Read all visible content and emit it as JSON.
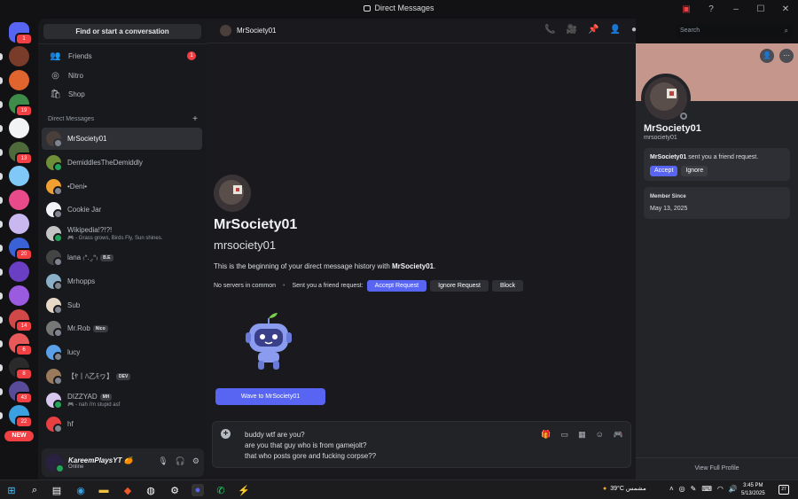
{
  "window": {
    "title": "Direct Messages"
  },
  "servers": [
    {
      "color": "#5865f2",
      "badge": "1"
    },
    {
      "color": "#7a3c2a",
      "badge": ""
    },
    {
      "color": "#e0642e",
      "badge": ""
    },
    {
      "color": "#3e8c4a",
      "badge": "19"
    },
    {
      "color": "#f2f3f5",
      "badge": ""
    },
    {
      "color": "#4e6a3a",
      "badge": "13"
    },
    {
      "color": "#7fc8f8",
      "badge": ""
    },
    {
      "color": "#e84a8a",
      "badge": ""
    },
    {
      "color": "#c9b8f0",
      "badge": ""
    },
    {
      "color": "#3a62d6",
      "badge": "20"
    },
    {
      "color": "#6b3fc4",
      "badge": ""
    },
    {
      "color": "#9a5be0",
      "badge": ""
    },
    {
      "color": "#d04848",
      "badge": "14"
    },
    {
      "color": "#e85a5a",
      "badge": "6"
    },
    {
      "color": "#2a2a2a",
      "badge": "8"
    },
    {
      "color": "#5a4a9a",
      "badge": "43"
    },
    {
      "color": "#3aa0e0",
      "badge": "22"
    }
  ],
  "new_badge": "NEW",
  "sidebar": {
    "find_placeholder": "Find or start a conversation",
    "nav": [
      {
        "label": "Friends",
        "badge": "1"
      },
      {
        "label": "Nitro",
        "badge": ""
      },
      {
        "label": "Shop",
        "badge": ""
      }
    ],
    "dm_header": "Direct Messages",
    "dms": [
      {
        "name": "MrSociety01",
        "sub": "",
        "tag": "",
        "color": "#4a3f3b",
        "status": "#80848e"
      },
      {
        "name": "DemiddlesTheDemiddly",
        "sub": "",
        "tag": "",
        "color": "#6f8e3a",
        "status": "#23a55a"
      },
      {
        "name": "•Deni•",
        "sub": "",
        "tag": "",
        "color": "#f0a030",
        "status": "#80848e"
      },
      {
        "name": "Cookie Jar",
        "sub": "",
        "tag": "",
        "color": "#f2f3f5",
        "status": "#80848e"
      },
      {
        "name": "Wikipedia!?!?!",
        "sub": "🎮 - Grass grows, Birds Fly, Sun shines.",
        "tag": "",
        "color": "#c4c4c4",
        "status": "#23a55a"
      },
      {
        "name": "lana ₍ᐢ. ̫.ᐢ₎",
        "sub": "",
        "tag": "B.E",
        "color": "#444",
        "status": "#80848e"
      },
      {
        "name": "Mrhopps",
        "sub": "",
        "tag": "",
        "color": "#8ab0c8",
        "status": "#80848e"
      },
      {
        "name": "Sub",
        "sub": "",
        "tag": "",
        "color": "#e8d8c8",
        "status": "#80848e"
      },
      {
        "name": "Mr.Rob",
        "sub": "",
        "tag": "Nico",
        "color": "#777",
        "status": "#80848e"
      },
      {
        "name": "lucy",
        "sub": "",
        "tag": "",
        "color": "#5aa0e8",
        "status": "#80848e"
      },
      {
        "name": "【ﾔ丨ﾊ乙ﾓヮ】",
        "sub": "",
        "tag": "DEV",
        "color": "#9a7a5a",
        "status": "#80848e"
      },
      {
        "name": "DIZZYAD",
        "sub": "🎮 - nah i'm stupid asf",
        "tag": "MH",
        "color": "#d8c8f0",
        "status": "#23a55a"
      },
      {
        "name": "hf",
        "sub": "",
        "tag": "",
        "color": "#e84040",
        "status": "#80848e"
      }
    ],
    "user": {
      "name": "KareemPlaysYT 🍊",
      "status": "Online"
    }
  },
  "header": {
    "name": "MrSociety01",
    "search_placeholder": "Search"
  },
  "intro": {
    "display_name": "MrSociety01",
    "username": "mrsociety01",
    "beginning_prefix": "This is the beginning of your direct message history with ",
    "beginning_name": "MrSociety01",
    "beginning_suffix": ".",
    "no_servers": "No servers in common",
    "sent_request": "Sent you a friend request:",
    "accept": "Accept Request",
    "ignore": "Ignore Request",
    "block": "Block",
    "wave": "Wave to MrSociety01"
  },
  "composer": {
    "lines": [
      "buddy wtf are you?",
      "are you that guy who is from gamejolt?",
      "that who posts gore and fucking corpse??"
    ]
  },
  "profile": {
    "name": "MrSociety01",
    "username": "mrsociety01",
    "request_user": "MrSociety01",
    "request_text": " sent you a friend request.",
    "accept": "Accept",
    "ignore": "Ignore",
    "member_since_label": "Member Since",
    "member_since": "May 13, 2025",
    "view_full": "View Full Profile",
    "banner_color": "#c5968c"
  },
  "taskbar": {
    "weather": "39°C مشمس",
    "time": "3:45 PM",
    "date": "5/13/2025",
    "notif": "27"
  }
}
